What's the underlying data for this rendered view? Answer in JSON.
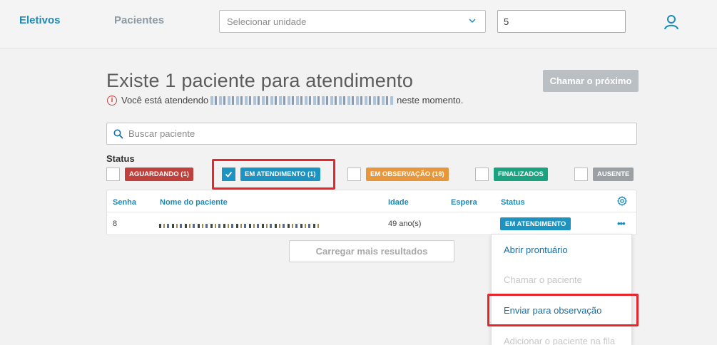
{
  "nav": {
    "tab_active": "Eletivos",
    "tab_inactive": "Pacientes",
    "unit_placeholder": "Selecionar unidade",
    "number_value": "5"
  },
  "main": {
    "title": "Existe 1 paciente para atendimento",
    "info_prefix": "Você está atendendo",
    "info_suffix": "neste momento.",
    "call_next_label": "Chamar o próximo",
    "search_placeholder": "Buscar paciente",
    "status_label": "Status"
  },
  "filters": [
    {
      "label": "AGUARDANDO (1)",
      "color": "#c0413b",
      "checked": false
    },
    {
      "label": "EM ATENDIMENTO (1)",
      "color": "#1c93c0",
      "checked": true
    },
    {
      "label": "EM OBSERVAÇÃO (18)",
      "color": "#e8963a",
      "checked": false
    },
    {
      "label": "FINALIZADOS",
      "color": "#1aa37e",
      "checked": false
    },
    {
      "label": "AUSENTE",
      "color": "#9ba0a4",
      "checked": false
    }
  ],
  "table": {
    "headers": {
      "senha": "Senha",
      "nome": "Nome do paciente",
      "idade": "Idade",
      "espera": "Espera",
      "status": "Status"
    },
    "rows": [
      {
        "senha": "8",
        "idade": "49 ano(s)",
        "espera": "",
        "status": "EM ATENDIMENTO"
      }
    ]
  },
  "load_more_label": "Carregar mais resultados",
  "menu": {
    "items": [
      {
        "label": "Abrir prontuário",
        "enabled": true
      },
      {
        "label": "Chamar o paciente",
        "enabled": false
      },
      {
        "label": "Enviar para observação",
        "enabled": true
      },
      {
        "label": "Adicionar o paciente na fila",
        "enabled": false
      }
    ]
  },
  "colors": {
    "accent": "#1b8bb9",
    "highlight": "#e5262c"
  }
}
